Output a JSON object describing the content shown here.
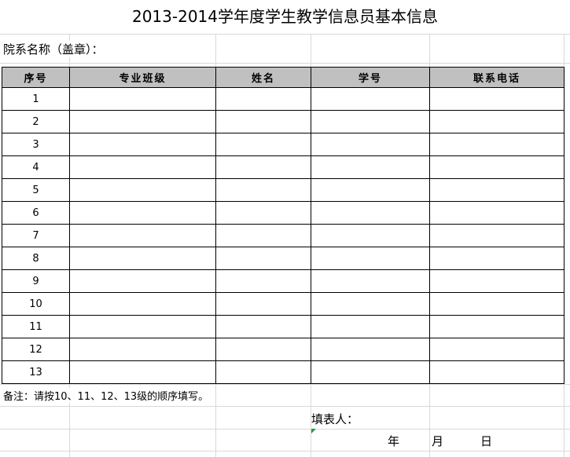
{
  "title": "2013-2014学年度学生教学信息员基本信息",
  "dept_label": "院系名称（盖章）：",
  "table": {
    "headers": [
      "序号",
      "专业班级",
      "姓名",
      "学号",
      "联系电话"
    ],
    "rows": [
      "1",
      "2",
      "3",
      "4",
      "5",
      "6",
      "7",
      "8",
      "9",
      "10",
      "11",
      "12",
      "13"
    ]
  },
  "note": "备注：请按10、11、12、13级的顺序填写。",
  "filler_label": "填表人：",
  "date": {
    "year": "年",
    "month": "月",
    "day": "日"
  }
}
